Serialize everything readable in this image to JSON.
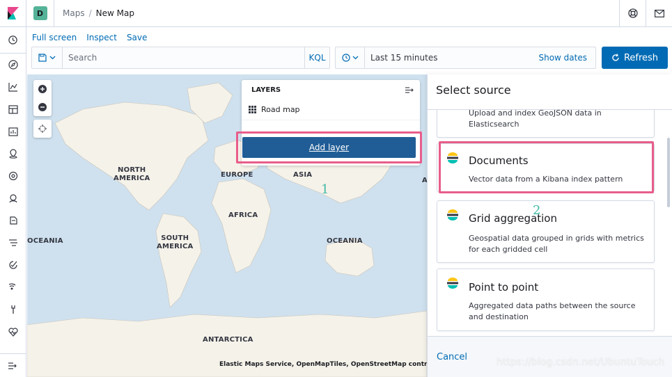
{
  "header": {
    "space_initial": "D",
    "breadcrumbs": [
      "Maps",
      "New Map"
    ],
    "separator": "/"
  },
  "app_menu": {
    "full_screen": "Full screen",
    "inspect": "Inspect",
    "save": "Save"
  },
  "query_bar": {
    "search_placeholder": "Search",
    "language": "KQL"
  },
  "date_picker": {
    "range": "Last 15 minutes",
    "show_dates": "Show dates",
    "refresh": "Refresh"
  },
  "map": {
    "labels": {
      "north_america": "NORTH\nAMERICA",
      "europe": "EUROPE",
      "asia": "ASIA",
      "africa": "AFRICA",
      "south_america": "SOUTH\nAMERICA",
      "oceania_left": "OCEANIA",
      "oceania_right": "OCEANIA",
      "antarctica": "ANTARCTICA",
      "edge_a": "A"
    },
    "attribution": "Elastic Maps Service, OpenMapTiles, OpenStreetMap contributors"
  },
  "layers_panel": {
    "title": "LAYERS",
    "layers": [
      {
        "name": "Road map"
      }
    ],
    "add_layer": "Add layer"
  },
  "annotations": {
    "step1": "1",
    "step2": "2"
  },
  "flyout": {
    "title": "Select source",
    "cards": [
      {
        "title": "",
        "description": "Upload and index GeoJSON data in Elasticsearch"
      },
      {
        "title": "Documents",
        "description": "Vector data from a Kibana index pattern"
      },
      {
        "title": "Grid aggregation",
        "description": "Geospatial data grouped in grids with metrics for each gridded cell"
      },
      {
        "title": "Point to point",
        "description": "Aggregated data paths between the source and destination"
      }
    ],
    "cancel": "Cancel"
  },
  "watermark": "https://blog.csdn.net/UbuntuTouch",
  "colors": {
    "primary": "#006bb4",
    "highlight": "#e85d8a",
    "annotation": "#3fb9a5",
    "water": "#cfe1ef",
    "land": "#f5f2ea"
  }
}
